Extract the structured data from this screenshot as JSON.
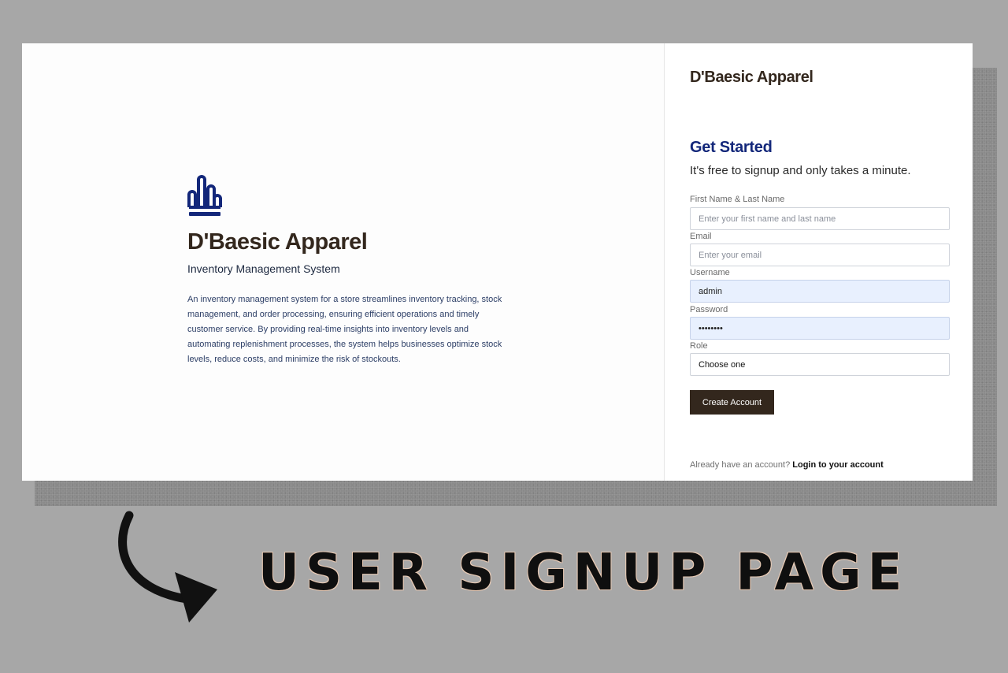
{
  "app": {
    "brand_name": "D'Baesic Apparel",
    "hero_title": "D'Baesic Apparel",
    "hero_subtitle": "Inventory Management System",
    "hero_description": "An inventory management system for a store streamlines inventory tracking, stock management, and order processing, ensuring efficient operations and timely customer service. By providing real-time insights into inventory levels and automating replenishment processes, the system helps businesses optimize stock levels, reduce costs, and minimize the risk of stockouts.",
    "logo_icon": "bar-chart-icon",
    "colors": {
      "brand_dark": "#33271d",
      "heading_blue": "#13277a",
      "autofill_bg": "#e8f0fe"
    }
  },
  "signup": {
    "title": "Get Started",
    "subtitle": "It's free to signup and only takes a minute.",
    "fields": {
      "name": {
        "label": "First Name & Last Name",
        "placeholder": "Enter your first name and last name",
        "value": ""
      },
      "email": {
        "label": "Email",
        "placeholder": "Enter your email",
        "value": ""
      },
      "username": {
        "label": "Username",
        "value": "admin"
      },
      "password": {
        "label": "Password",
        "value": "••••••••"
      },
      "role": {
        "label": "Role",
        "selected": "Choose one"
      }
    },
    "submit_label": "Create Account",
    "login_prompt": "Already have an account?",
    "login_link": "Login to your account"
  },
  "banner": {
    "caption": "USER SIGNUP PAGE",
    "arrow_icon": "curved-arrow-icon"
  }
}
